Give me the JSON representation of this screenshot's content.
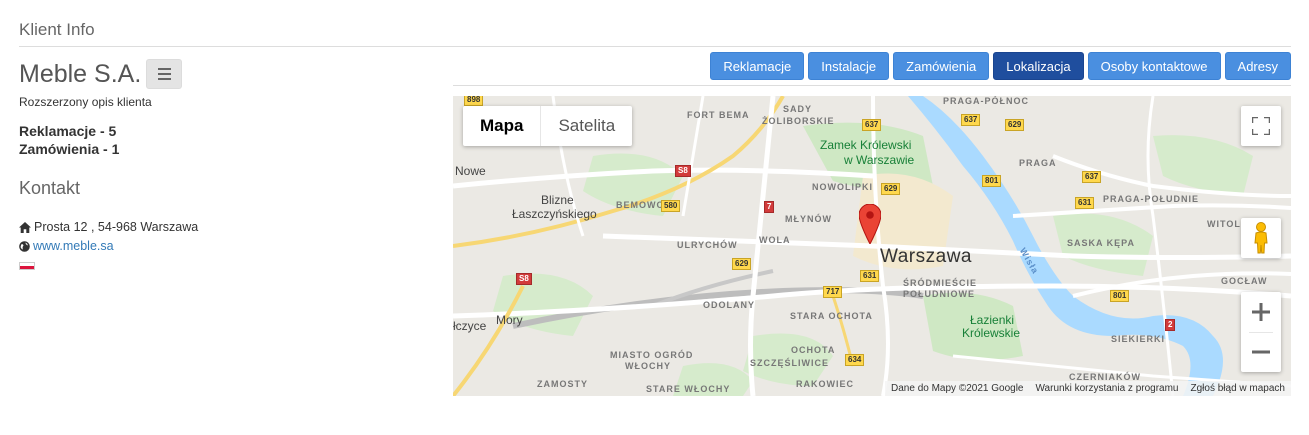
{
  "page": {
    "title": "Klient Info"
  },
  "client": {
    "name": "Meble S.A.",
    "description": "Rozszerzony opis klienta",
    "stats": [
      "Reklamacje - 5",
      "Zamówienia - 1"
    ],
    "menu_icon": "bars-icon"
  },
  "contact": {
    "title": "Kontakt",
    "address": "Prosta 12 , 54-968 Warszawa",
    "address_icon": "home-icon",
    "website": "www.meble.sa",
    "website_icon": "globe-icon",
    "flag": "poland-flag"
  },
  "tabs": [
    {
      "label": "Reklamacje",
      "active": false
    },
    {
      "label": "Instalacje",
      "active": false
    },
    {
      "label": "Zamówienia",
      "active": false
    },
    {
      "label": "Lokalizacja",
      "active": true
    },
    {
      "label": "Osoby kontaktowe",
      "active": false
    },
    {
      "label": "Adresy",
      "active": false
    }
  ],
  "map": {
    "type_buttons": [
      "Mapa",
      "Satelita"
    ],
    "active_type": "Mapa",
    "attribution": [
      "Dane do Mapy ©2021 Google",
      "Warunki korzystania z programu",
      "Zgłoś błąd w mapach"
    ],
    "labels": {
      "city": "Warszawa",
      "nowe": "Nowe",
      "blizne": "Blizne",
      "laszczynskiego": "Łaszczyńskiego",
      "mory": "Mory",
      "czyce": "łczyce",
      "zamek1": "Zamek Królewski",
      "zamek2": "w Warszawie",
      "lazienki1": "Łazienki",
      "lazienki2": "Królewskie",
      "fortbema": "FORT BEMA",
      "sady1": "SADY",
      "sady2": "ŻOLIBORSKIE",
      "pragapolnoc": "PRAGA-PÓŁNOC",
      "praga": "PRAGA",
      "nowolipki": "NOWOLIPKI",
      "bemowo": "BEMOWO",
      "mlynow": "MŁYNÓW",
      "ulrychow": "ULRYCHÓW",
      "wola": "WOLA",
      "pragapoludnie": "PRAGA-POŁUDNIE",
      "witolin": "WITOLIN",
      "saskakepa": "SASKA KĘPA",
      "goclaw": "GOCŁAW",
      "srodmiescie1": "ŚRÓDMIEŚCIE",
      "srodmiescie2": "POŁUDNIOWE",
      "odolany": "ODOLANY",
      "staraochota": "STARA OCHOTA",
      "ochota": "OCHOTA",
      "miasto1": "MIASTO OGRÓD",
      "miasto2": "WŁOCHY",
      "szczesliwice": "SZCZĘŚLIWICE",
      "siekierki": "SIEKIERKI",
      "zamosty": "ZAMOSTY",
      "rakowiec": "RAKOWIEC",
      "starewlochy": "STARE WŁOCHY",
      "czerniakow": "CZERNIAKÓW",
      "wisla": "Wisła"
    },
    "shields": [
      "898",
      "637",
      "637",
      "629",
      "S8",
      "580",
      "7",
      "629",
      "801",
      "637",
      "631",
      "629",
      "717",
      "631",
      "801",
      "634",
      "S8",
      "2"
    ]
  }
}
